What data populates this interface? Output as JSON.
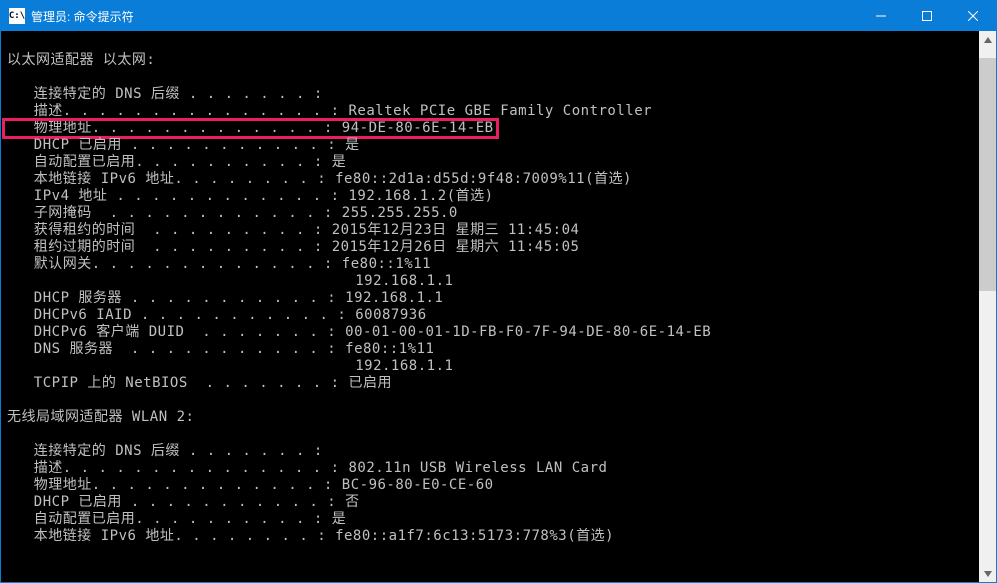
{
  "titlebar": {
    "icon_text": "C:\\",
    "title": "管理员: 命令提示符"
  },
  "sections": {
    "ethernet": {
      "title": "以太网适配器 以太网:",
      "rows": [
        {
          "label": "   连接特定的 DNS 后缀 . . . . . . . :",
          "value": ""
        },
        {
          "label": "   描述. . . . . . . . . . . . . . . :",
          "value": "Realtek PCIe GBE Family Controller"
        },
        {
          "label": "   物理地址. . . . . . . . . . . . . :",
          "value": "94-DE-80-6E-14-EB",
          "highlight": true
        },
        {
          "label": "   DHCP 已启用 . . . . . . . . . . . :",
          "value": "是"
        },
        {
          "label": "   自动配置已启用. . . . . . . . . . :",
          "value": "是"
        },
        {
          "label": "   本地链接 IPv6 地址. . . . . . . . :",
          "value": "fe80::2d1a:d55d:9f48:7009%11(首选)"
        },
        {
          "label": "   IPv4 地址 . . . . . . . . . . . . :",
          "value": "192.168.1.2(首选)"
        },
        {
          "label": "   子网掩码  . . . . . . . . . . . . :",
          "value": "255.255.255.0"
        },
        {
          "label": "   获得租约的时间  . . . . . . . . . :",
          "value": "2015年12月23日 星期三 11:45:04"
        },
        {
          "label": "   租约过期的时间  . . . . . . . . . :",
          "value": "2015年12月26日 星期六 11:45:05"
        },
        {
          "label": "   默认网关. . . . . . . . . . . . . :",
          "value": "fe80::1%11"
        },
        {
          "label": "                                      ",
          "value": "192.168.1.1"
        },
        {
          "label": "   DHCP 服务器 . . . . . . . . . . . :",
          "value": "192.168.1.1"
        },
        {
          "label": "   DHCPv6 IAID . . . . . . . . . . . :",
          "value": "60087936"
        },
        {
          "label": "   DHCPv6 客户端 DUID  . . . . . . . :",
          "value": "00-01-00-01-1D-FB-F0-7F-94-DE-80-6E-14-EB"
        },
        {
          "label": "   DNS 服务器  . . . . . . . . . . . :",
          "value": "fe80::1%11"
        },
        {
          "label": "                                      ",
          "value": "192.168.1.1"
        },
        {
          "label": "   TCPIP 上的 NetBIOS  . . . . . . . :",
          "value": "已启用"
        }
      ]
    },
    "wlan": {
      "title": "无线局域网适配器 WLAN 2:",
      "rows": [
        {
          "label": "   连接特定的 DNS 后缀 . . . . . . . :",
          "value": ""
        },
        {
          "label": "   描述. . . . . . . . . . . . . . . :",
          "value": "802.11n USB Wireless LAN Card"
        },
        {
          "label": "   物理地址. . . . . . . . . . . . . :",
          "value": "BC-96-80-E0-CE-60"
        },
        {
          "label": "   DHCP 已启用 . . . . . . . . . . . :",
          "value": "否"
        },
        {
          "label": "   自动配置已启用. . . . . . . . . . :",
          "value": "是"
        },
        {
          "label": "   本地链接 IPv6 地址. . . . . . . . :",
          "value": "fe80::a1f7:6c13:5173:778%3(首选)"
        }
      ]
    }
  }
}
